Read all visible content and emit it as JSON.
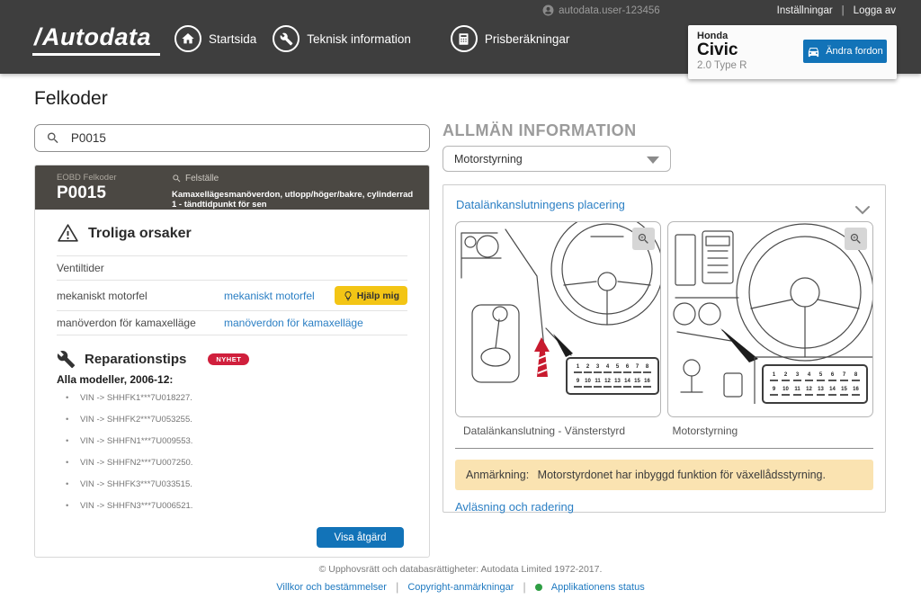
{
  "header": {
    "logo_text": "Autodata",
    "nav": [
      {
        "label": "Startsida",
        "icon": "home-icon"
      },
      {
        "label": "Teknisk information",
        "icon": "wrench-icon"
      },
      {
        "label": "Prisberäkningar",
        "icon": "calculator-icon"
      }
    ],
    "username": "autodata.user-123456",
    "settings_label": "Inställningar",
    "logout_label": "Logga av",
    "vehicle": {
      "make": "Honda",
      "model": "Civic",
      "variant": "2.0 Type R",
      "change_button": "Ändra fordon"
    }
  },
  "page": {
    "title": "Felkoder"
  },
  "search": {
    "value": "P0015"
  },
  "fault_card": {
    "head": {
      "category": "EOBD Felkoder",
      "code": "P0015",
      "location_label": "Felställe",
      "description": "Kamaxellägesmanöverdon, utlopp/höger/bakre, cylinderrad 1 - tändtidpunkt för sen"
    },
    "causes": {
      "title": "Troliga orsaker",
      "help_button": "Hjälp mig",
      "rows": [
        {
          "label": "Ventiltider",
          "link": ""
        },
        {
          "label": "mekaniskt motorfel",
          "link": "mekaniskt motorfel"
        },
        {
          "label": "manöverdon för kamaxelläge",
          "link": "manöverdon för kamaxelläge"
        }
      ]
    },
    "repair_tips": {
      "title": "Reparationstips",
      "badge": "NYHET",
      "subtitle": "Alla modeller, 2006-12:",
      "vins": [
        "VIN -> SHHFK1***7U018227.",
        "VIN -> SHHFK2***7U053255.",
        "VIN -> SHHFN1***7U009553.",
        "VIN -> SHHFN2***7U007250.",
        "VIN -> SHHFK3***7U033515.",
        "VIN -> SHHFN3***7U006521."
      ]
    },
    "action_button": "Visa åtgärd"
  },
  "info_panel": {
    "title": "ALLMÄN INFORMATION",
    "dropdown_value": "Motorstyrning",
    "section_link": "Datalänkanslutningens placering",
    "diagrams": [
      {
        "caption": "Datalänkanslutning - Vänsterstyrd",
        "pins_top": [
          "1",
          "2",
          "3",
          "4",
          "5",
          "6",
          "7",
          "8"
        ],
        "pins_bottom": [
          "9",
          "10",
          "11",
          "12",
          "13",
          "14",
          "15",
          "16"
        ]
      },
      {
        "caption": "Motorstyrning",
        "pins_top": [
          "1",
          "2",
          "3",
          "4",
          "5",
          "6",
          "7",
          "8"
        ],
        "pins_bottom": [
          "9",
          "10",
          "11",
          "12",
          "13",
          "14",
          "15",
          "16"
        ]
      }
    ],
    "note_label": "Anmärkning:",
    "note_text": "Motorstyrdonet har inbyggd funktion för växellådsstyrning.",
    "bottom_link": "Avläsning och radering"
  },
  "footer": {
    "copyright": "© Upphovsrätt och databasrättigheter: Autodata Limited 1972-2017.",
    "links": [
      "Villkor och bestämmelser",
      "Copyright-anmärkningar",
      "Applikationens status"
    ]
  },
  "colors": {
    "header_bg": "#3E3E3E",
    "fault_head_bg": "#4B4843",
    "accent_blue": "#1273B8",
    "link_blue": "#2B7FC4",
    "help_yellow": "#F3C515",
    "badge_red": "#D01F3C",
    "note_bg": "#FAE3B1",
    "status_green": "#2F9E44"
  }
}
